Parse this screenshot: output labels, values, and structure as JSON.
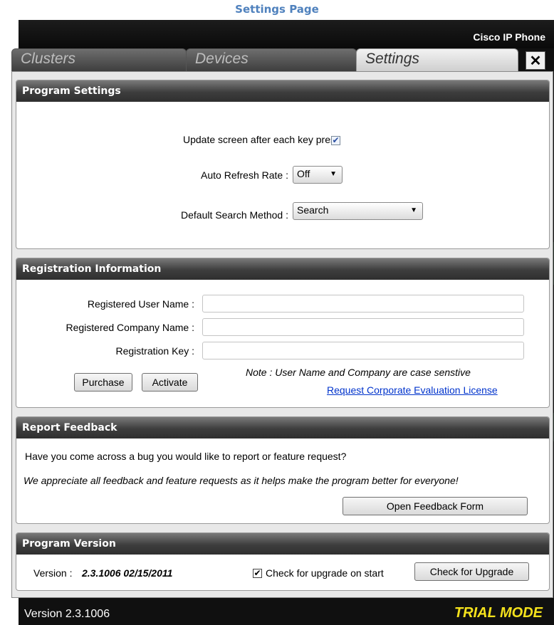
{
  "caption": "Settings Page",
  "window": {
    "title": "Cisco IP Phone",
    "close_glyph": "✕"
  },
  "tabs": [
    {
      "label": "Clusters"
    },
    {
      "label": "Devices"
    },
    {
      "label": "Settings",
      "active": true
    }
  ],
  "program_settings": {
    "header": "Program Settings",
    "update_label": "Update screen after each key press",
    "update_checked": true,
    "refresh_label": "Auto Refresh Rate :",
    "refresh_value": "Off",
    "search_label": "Default Search Method :",
    "search_value": "Search"
  },
  "registration": {
    "header": "Registration Information",
    "user_label": "Registered User Name :",
    "user_value": "",
    "company_label": "Registered Company Name :",
    "company_value": "",
    "key_label": "Registration Key :",
    "key_value": "",
    "purchase_label": "Purchase",
    "activate_label": "Activate",
    "note": "Note : User Name and Company are case senstive",
    "eval_link": "Request Corporate Evaluation License"
  },
  "feedback": {
    "header": "Report Feedback",
    "question": "Have you come across a bug you would like to report or feature request?",
    "appreciation": "We appreciate all feedback and feature requests as it helps make the program better for everyone!",
    "button_label": "Open Feedback Form"
  },
  "version": {
    "header": "Program Version",
    "label": "Version :",
    "value": "2.3.1006 02/15/2011",
    "upgrade_check_label": "Check for upgrade on start",
    "upgrade_checked": true,
    "upgrade_button": "Check for Upgrade"
  },
  "status_bar": {
    "version": "Version 2.3.1006",
    "mode": "TRIAL MODE"
  },
  "colors": {
    "caption": "#4f81bd",
    "trial": "#f5e21c",
    "link": "#0033cc"
  },
  "icons": {
    "checkbox_check": "✔",
    "dropdown": "▼"
  }
}
